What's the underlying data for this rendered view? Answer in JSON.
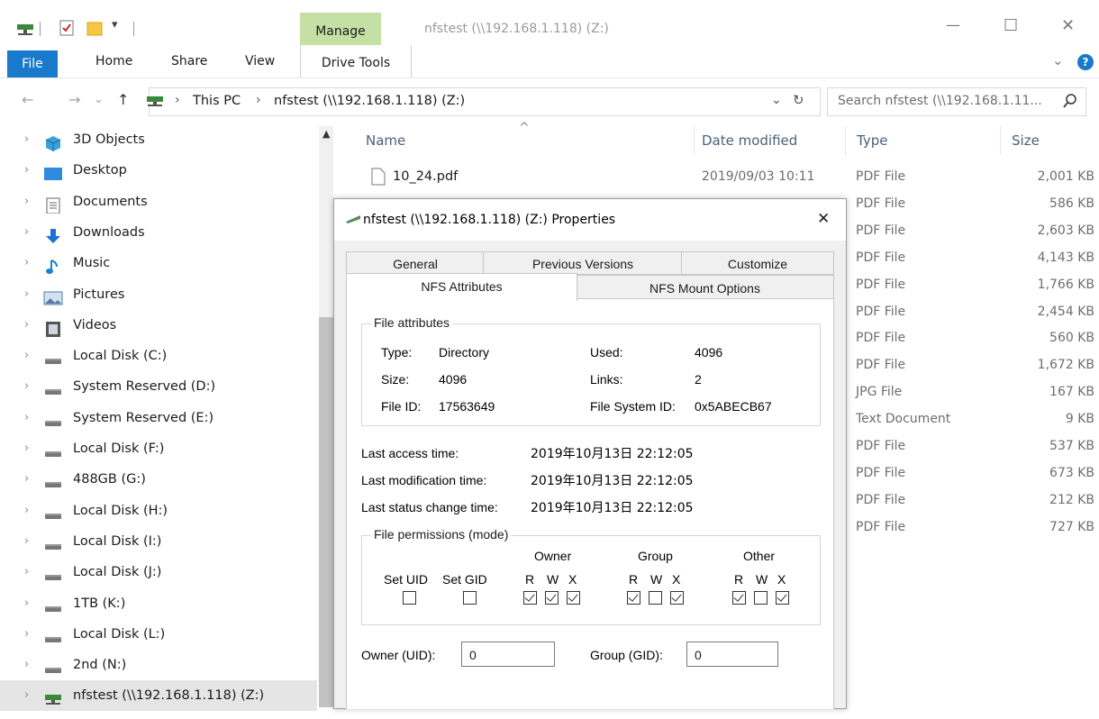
{
  "window": {
    "title": "nfstest (\\\\192.168.1.118) (Z:)",
    "manage_tab": "Manage",
    "drive_tools_tab": "Drive Tools",
    "minimize": "—",
    "maximize": "☐",
    "close": "✕"
  },
  "ribbon": {
    "tabs": [
      "File",
      "Home",
      "Share",
      "View"
    ],
    "expand": "⌄",
    "help": "?"
  },
  "address": {
    "back": "←",
    "forward": "→",
    "recent": "⌄",
    "up": "↑",
    "crumb_sep": "›",
    "crumbs": [
      "This PC",
      "nfstest (\\\\192.168.1.118) (Z:)"
    ],
    "dropdown": "⌄",
    "refresh": "↻",
    "search_placeholder": "Search nfstest (\\\\192.168.1.11..."
  },
  "sidebar": {
    "chevron": "›",
    "items": [
      {
        "label": "3D Objects",
        "icon": "3d-objects-icon"
      },
      {
        "label": "Desktop",
        "icon": "desktop-icon"
      },
      {
        "label": "Documents",
        "icon": "documents-icon"
      },
      {
        "label": "Downloads",
        "icon": "downloads-icon"
      },
      {
        "label": "Music",
        "icon": "music-icon"
      },
      {
        "label": "Pictures",
        "icon": "pictures-icon"
      },
      {
        "label": "Videos",
        "icon": "videos-icon"
      },
      {
        "label": "Local Disk (C:)",
        "icon": "drive-icon"
      },
      {
        "label": "System Reserved (D:)",
        "icon": "drive-icon"
      },
      {
        "label": "System Reserved (E:)",
        "icon": "drive-icon"
      },
      {
        "label": "Local Disk (F:)",
        "icon": "drive-icon"
      },
      {
        "label": "488GB (G:)",
        "icon": "drive-icon"
      },
      {
        "label": "Local Disk (H:)",
        "icon": "drive-icon"
      },
      {
        "label": "Local Disk (I:)",
        "icon": "drive-icon"
      },
      {
        "label": "Local Disk (J:)",
        "icon": "drive-icon"
      },
      {
        "label": "1TB (K:)",
        "icon": "drive-icon"
      },
      {
        "label": "Local Disk (L:)",
        "icon": "drive-icon"
      },
      {
        "label": "2nd (N:)",
        "icon": "drive-icon"
      },
      {
        "label": "nfstest (\\\\192.168.1.118) (Z:)",
        "icon": "network-drive-icon"
      }
    ]
  },
  "list": {
    "sort_arrow": "^",
    "headers": {
      "name": "Name",
      "date": "Date modified",
      "type": "Type",
      "size": "Size"
    },
    "first_file": {
      "name": "10_24.pdf",
      "date": "2019/09/03 10:11"
    },
    "rows": [
      {
        "type": "PDF File",
        "size": "2,001 KB"
      },
      {
        "type": "PDF File",
        "size": "586 KB"
      },
      {
        "type": "PDF File",
        "size": "2,603 KB"
      },
      {
        "type": "PDF File",
        "size": "4,143 KB"
      },
      {
        "type": "PDF File",
        "size": "1,766 KB"
      },
      {
        "type": "PDF File",
        "size": "2,454 KB"
      },
      {
        "type": "PDF File",
        "size": "560 KB"
      },
      {
        "type": "PDF File",
        "size": "1,672 KB"
      },
      {
        "type": "JPG File",
        "size": "167 KB"
      },
      {
        "type": "Text Document",
        "size": "9 KB"
      },
      {
        "type": "PDF File",
        "size": "537 KB"
      },
      {
        "type": "PDF File",
        "size": "673 KB"
      },
      {
        "type": "PDF File",
        "size": "212 KB"
      },
      {
        "type": "PDF File",
        "size": "727 KB"
      }
    ]
  },
  "dialog": {
    "title": "nfstest (\\\\192.168.1.118) (Z:) Properties",
    "close": "✕",
    "tabs_row1": [
      "General",
      "Previous Versions",
      "Customize"
    ],
    "tabs_row2": [
      "NFS Attributes",
      "NFS Mount Options"
    ],
    "file_attributes": {
      "legend": "File attributes",
      "type_label": "Type:",
      "type_value": "Directory",
      "size_label": "Size:",
      "size_value": "4096",
      "fileid_label": "File ID:",
      "fileid_value": "17563649",
      "used_label": "Used:",
      "used_value": "4096",
      "links_label": "Links:",
      "links_value": "2",
      "fsid_label": "File System ID:",
      "fsid_value": "0x5ABECB67"
    },
    "times": {
      "access_label": "Last access time:",
      "access_value": "2019年10月13日  22:12:05",
      "mod_label": "Last modification time:",
      "mod_value": "2019年10月13日  22:12:05",
      "status_label": "Last status change time:",
      "status_value": "2019年10月13日  22:12:05"
    },
    "permissions": {
      "legend": "File permissions (mode)",
      "set_uid": "Set UID",
      "set_gid": "Set GID",
      "set_uid_checked": false,
      "set_gid_checked": false,
      "groups": [
        {
          "name": "Owner",
          "r": true,
          "w": true,
          "x": true
        },
        {
          "name": "Group",
          "r": true,
          "w": false,
          "x": true
        },
        {
          "name": "Other",
          "r": true,
          "w": false,
          "x": true
        }
      ],
      "r": "R",
      "w": "W",
      "x": "X"
    },
    "owner_label": "Owner (UID):",
    "owner_value": "0",
    "group_label": "Group (GID):",
    "group_value": "0"
  }
}
